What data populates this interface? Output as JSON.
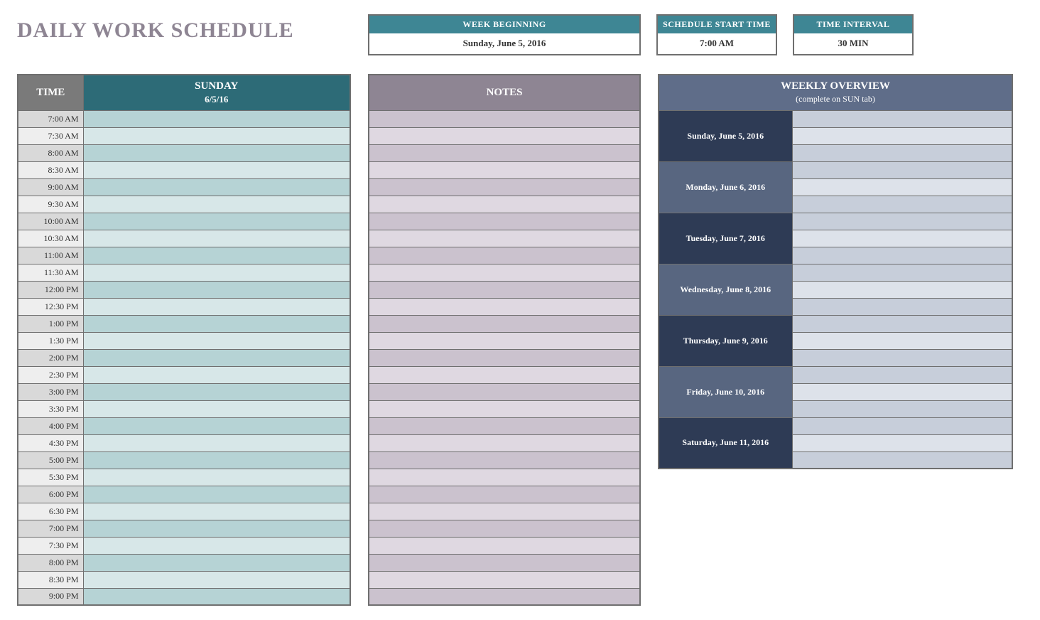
{
  "title": "DAILY WORK SCHEDULE",
  "info": {
    "week_label": "WEEK BEGINNING",
    "week_value": "Sunday, June 5, 2016",
    "start_label": "SCHEDULE START TIME",
    "start_value": "7:00 AM",
    "interval_label": "TIME INTERVAL",
    "interval_value": "30 MIN"
  },
  "schedule": {
    "time_header": "TIME",
    "day_header": "SUNDAY",
    "day_sub": "6/5/16",
    "times": [
      "7:00 AM",
      "7:30 AM",
      "8:00 AM",
      "8:30 AM",
      "9:00 AM",
      "9:30 AM",
      "10:00 AM",
      "10:30 AM",
      "11:00 AM",
      "11:30 AM",
      "12:00 PM",
      "12:30 PM",
      "1:00 PM",
      "1:30 PM",
      "2:00 PM",
      "2:30 PM",
      "3:00 PM",
      "3:30 PM",
      "4:00 PM",
      "4:30 PM",
      "5:00 PM",
      "5:30 PM",
      "6:00 PM",
      "6:30 PM",
      "7:00 PM",
      "7:30 PM",
      "8:00 PM",
      "8:30 PM",
      "9:00 PM"
    ]
  },
  "notes": {
    "header": "NOTES",
    "row_count": 29
  },
  "overview": {
    "header": "WEEKLY OVERVIEW",
    "sub": "(complete on SUN tab)",
    "days": [
      "Sunday, June 5, 2016",
      "Monday, June 6, 2016",
      "Tuesday, June 7, 2016",
      "Wednesday, June 8, 2016",
      "Thursday, June 9, 2016",
      "Friday, June 10, 2016",
      "Saturday, June 11, 2016"
    ]
  }
}
